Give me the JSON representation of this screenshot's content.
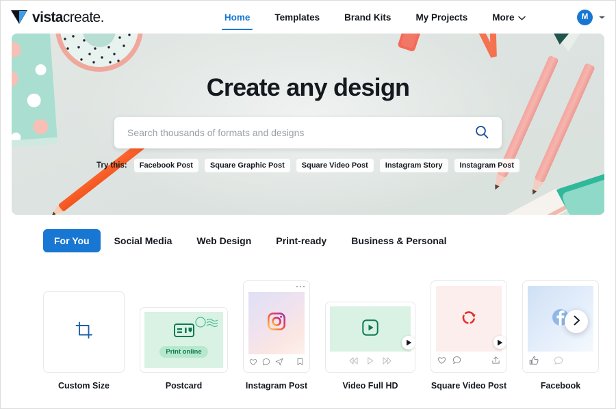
{
  "brand": {
    "name_bold": "vista",
    "name_regular": "create.",
    "accent": "#1877d2",
    "logo_icon": "vistacreate-triangle-logo"
  },
  "header": {
    "nav": [
      {
        "label": "Home",
        "active": true
      },
      {
        "label": "Templates",
        "active": false
      },
      {
        "label": "Brand Kits",
        "active": false
      },
      {
        "label": "My Projects",
        "active": false
      },
      {
        "label": "More",
        "active": false,
        "caret": true
      }
    ],
    "account": {
      "initial": "M",
      "caret_icon": "chevron-down-icon"
    }
  },
  "hero": {
    "title": "Create any design",
    "search": {
      "value": "",
      "placeholder": "Search thousands of formats and designs",
      "icon": "search-icon"
    },
    "try_label": "Try this:",
    "chips": [
      "Facebook Post",
      "Square Graphic Post",
      "Square Video Post",
      "Instagram Story",
      "Instagram Post"
    ]
  },
  "tabs": [
    {
      "label": "For You",
      "active": true
    },
    {
      "label": "Social Media",
      "active": false
    },
    {
      "label": "Web Design",
      "active": false
    },
    {
      "label": "Print-ready",
      "active": false
    },
    {
      "label": "Business & Personal",
      "active": false
    }
  ],
  "cards": [
    {
      "label": "Custom Size",
      "icon": "crop-icon"
    },
    {
      "label": "Postcard",
      "icon": "postcard-icon",
      "badge": "Print online"
    },
    {
      "label": "Instagram Post",
      "icon": "instagram-icon"
    },
    {
      "label": "Video Full HD",
      "icon": "play-square-icon"
    },
    {
      "label": "Square Video Post",
      "icon": "circular-arrow-icon"
    },
    {
      "label": "Facebook",
      "icon": "facebook-icon"
    }
  ],
  "carousel": {
    "next_label": "next-arrow-icon"
  }
}
